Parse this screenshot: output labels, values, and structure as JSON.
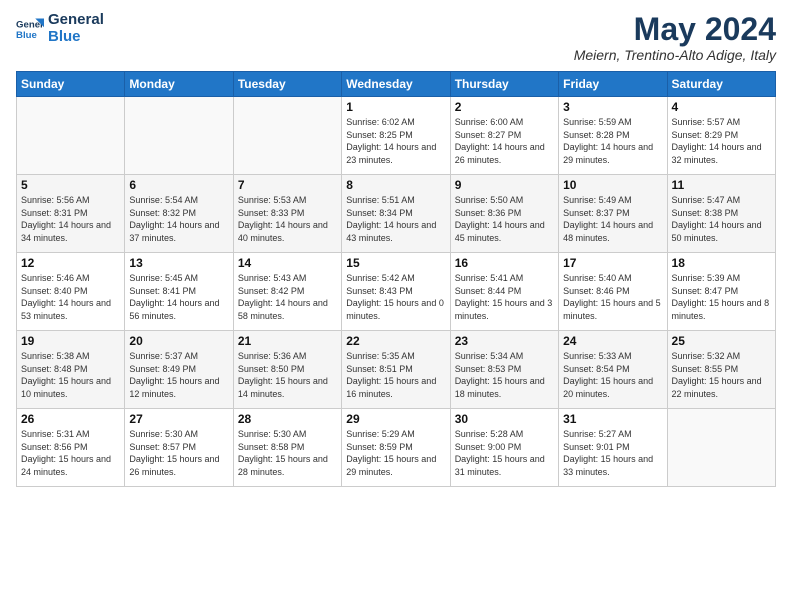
{
  "logo": {
    "line1": "General",
    "line2": "Blue"
  },
  "title": "May 2024",
  "location": "Meiern, Trentino-Alto Adige, Italy",
  "days_of_week": [
    "Sunday",
    "Monday",
    "Tuesday",
    "Wednesday",
    "Thursday",
    "Friday",
    "Saturday"
  ],
  "weeks": [
    [
      {
        "day": "",
        "sunrise": "",
        "sunset": "",
        "daylight": ""
      },
      {
        "day": "",
        "sunrise": "",
        "sunset": "",
        "daylight": ""
      },
      {
        "day": "",
        "sunrise": "",
        "sunset": "",
        "daylight": ""
      },
      {
        "day": "1",
        "sunrise": "Sunrise: 6:02 AM",
        "sunset": "Sunset: 8:25 PM",
        "daylight": "Daylight: 14 hours and 23 minutes."
      },
      {
        "day": "2",
        "sunrise": "Sunrise: 6:00 AM",
        "sunset": "Sunset: 8:27 PM",
        "daylight": "Daylight: 14 hours and 26 minutes."
      },
      {
        "day": "3",
        "sunrise": "Sunrise: 5:59 AM",
        "sunset": "Sunset: 8:28 PM",
        "daylight": "Daylight: 14 hours and 29 minutes."
      },
      {
        "day": "4",
        "sunrise": "Sunrise: 5:57 AM",
        "sunset": "Sunset: 8:29 PM",
        "daylight": "Daylight: 14 hours and 32 minutes."
      }
    ],
    [
      {
        "day": "5",
        "sunrise": "Sunrise: 5:56 AM",
        "sunset": "Sunset: 8:31 PM",
        "daylight": "Daylight: 14 hours and 34 minutes."
      },
      {
        "day": "6",
        "sunrise": "Sunrise: 5:54 AM",
        "sunset": "Sunset: 8:32 PM",
        "daylight": "Daylight: 14 hours and 37 minutes."
      },
      {
        "day": "7",
        "sunrise": "Sunrise: 5:53 AM",
        "sunset": "Sunset: 8:33 PM",
        "daylight": "Daylight: 14 hours and 40 minutes."
      },
      {
        "day": "8",
        "sunrise": "Sunrise: 5:51 AM",
        "sunset": "Sunset: 8:34 PM",
        "daylight": "Daylight: 14 hours and 43 minutes."
      },
      {
        "day": "9",
        "sunrise": "Sunrise: 5:50 AM",
        "sunset": "Sunset: 8:36 PM",
        "daylight": "Daylight: 14 hours and 45 minutes."
      },
      {
        "day": "10",
        "sunrise": "Sunrise: 5:49 AM",
        "sunset": "Sunset: 8:37 PM",
        "daylight": "Daylight: 14 hours and 48 minutes."
      },
      {
        "day": "11",
        "sunrise": "Sunrise: 5:47 AM",
        "sunset": "Sunset: 8:38 PM",
        "daylight": "Daylight: 14 hours and 50 minutes."
      }
    ],
    [
      {
        "day": "12",
        "sunrise": "Sunrise: 5:46 AM",
        "sunset": "Sunset: 8:40 PM",
        "daylight": "Daylight: 14 hours and 53 minutes."
      },
      {
        "day": "13",
        "sunrise": "Sunrise: 5:45 AM",
        "sunset": "Sunset: 8:41 PM",
        "daylight": "Daylight: 14 hours and 56 minutes."
      },
      {
        "day": "14",
        "sunrise": "Sunrise: 5:43 AM",
        "sunset": "Sunset: 8:42 PM",
        "daylight": "Daylight: 14 hours and 58 minutes."
      },
      {
        "day": "15",
        "sunrise": "Sunrise: 5:42 AM",
        "sunset": "Sunset: 8:43 PM",
        "daylight": "Daylight: 15 hours and 0 minutes."
      },
      {
        "day": "16",
        "sunrise": "Sunrise: 5:41 AM",
        "sunset": "Sunset: 8:44 PM",
        "daylight": "Daylight: 15 hours and 3 minutes."
      },
      {
        "day": "17",
        "sunrise": "Sunrise: 5:40 AM",
        "sunset": "Sunset: 8:46 PM",
        "daylight": "Daylight: 15 hours and 5 minutes."
      },
      {
        "day": "18",
        "sunrise": "Sunrise: 5:39 AM",
        "sunset": "Sunset: 8:47 PM",
        "daylight": "Daylight: 15 hours and 8 minutes."
      }
    ],
    [
      {
        "day": "19",
        "sunrise": "Sunrise: 5:38 AM",
        "sunset": "Sunset: 8:48 PM",
        "daylight": "Daylight: 15 hours and 10 minutes."
      },
      {
        "day": "20",
        "sunrise": "Sunrise: 5:37 AM",
        "sunset": "Sunset: 8:49 PM",
        "daylight": "Daylight: 15 hours and 12 minutes."
      },
      {
        "day": "21",
        "sunrise": "Sunrise: 5:36 AM",
        "sunset": "Sunset: 8:50 PM",
        "daylight": "Daylight: 15 hours and 14 minutes."
      },
      {
        "day": "22",
        "sunrise": "Sunrise: 5:35 AM",
        "sunset": "Sunset: 8:51 PM",
        "daylight": "Daylight: 15 hours and 16 minutes."
      },
      {
        "day": "23",
        "sunrise": "Sunrise: 5:34 AM",
        "sunset": "Sunset: 8:53 PM",
        "daylight": "Daylight: 15 hours and 18 minutes."
      },
      {
        "day": "24",
        "sunrise": "Sunrise: 5:33 AM",
        "sunset": "Sunset: 8:54 PM",
        "daylight": "Daylight: 15 hours and 20 minutes."
      },
      {
        "day": "25",
        "sunrise": "Sunrise: 5:32 AM",
        "sunset": "Sunset: 8:55 PM",
        "daylight": "Daylight: 15 hours and 22 minutes."
      }
    ],
    [
      {
        "day": "26",
        "sunrise": "Sunrise: 5:31 AM",
        "sunset": "Sunset: 8:56 PM",
        "daylight": "Daylight: 15 hours and 24 minutes."
      },
      {
        "day": "27",
        "sunrise": "Sunrise: 5:30 AM",
        "sunset": "Sunset: 8:57 PM",
        "daylight": "Daylight: 15 hours and 26 minutes."
      },
      {
        "day": "28",
        "sunrise": "Sunrise: 5:30 AM",
        "sunset": "Sunset: 8:58 PM",
        "daylight": "Daylight: 15 hours and 28 minutes."
      },
      {
        "day": "29",
        "sunrise": "Sunrise: 5:29 AM",
        "sunset": "Sunset: 8:59 PM",
        "daylight": "Daylight: 15 hours and 29 minutes."
      },
      {
        "day": "30",
        "sunrise": "Sunrise: 5:28 AM",
        "sunset": "Sunset: 9:00 PM",
        "daylight": "Daylight: 15 hours and 31 minutes."
      },
      {
        "day": "31",
        "sunrise": "Sunrise: 5:27 AM",
        "sunset": "Sunset: 9:01 PM",
        "daylight": "Daylight: 15 hours and 33 minutes."
      },
      {
        "day": "",
        "sunrise": "",
        "sunset": "",
        "daylight": ""
      }
    ]
  ]
}
